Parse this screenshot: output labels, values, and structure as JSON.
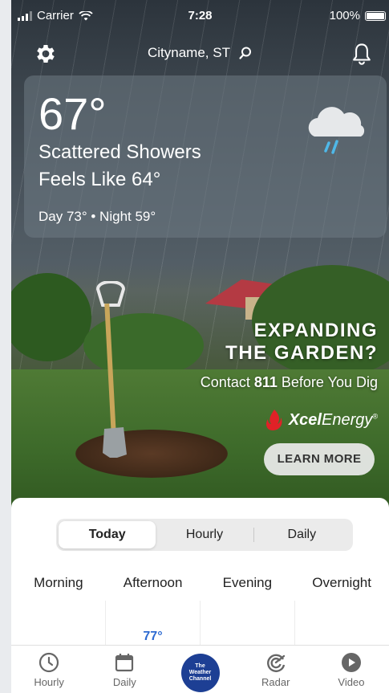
{
  "status": {
    "carrier": "Carrier",
    "time": "7:28",
    "battery": "100%"
  },
  "header": {
    "location": "Cityname, ST"
  },
  "current": {
    "temperature": "67°",
    "phrase": "Scattered Showers",
    "feels_like": "Feels Like 64°",
    "day_night": "Day 73° • Night 59°",
    "icon": "cloud-rain-icon"
  },
  "ad": {
    "headline_1": "EXPANDING",
    "headline_2": "THE GARDEN?",
    "sub_prefix": "Contact ",
    "sub_bold": "811",
    "sub_suffix": " Before You Dig",
    "brand_bold": "Xcel",
    "brand_rest": "Energy",
    "brand_mark": "®",
    "cta": "LEARN MORE"
  },
  "forecast": {
    "tabs": [
      "Today",
      "Hourly",
      "Daily"
    ],
    "active_tab": "Today",
    "dayparts": [
      "Morning",
      "Afternoon",
      "Evening",
      "Overnight"
    ],
    "afternoon_high": "77°"
  },
  "tabbar": {
    "items": [
      {
        "label": "Hourly",
        "icon": "clock-icon"
      },
      {
        "label": "Daily",
        "icon": "calendar-icon"
      },
      {
        "label": "",
        "logo_line1": "The",
        "logo_line2": "Weather",
        "logo_line3": "Channel",
        "icon": "weather-channel-logo"
      },
      {
        "label": "Radar",
        "icon": "radar-icon"
      },
      {
        "label": "Video",
        "icon": "play-icon"
      }
    ]
  },
  "colors": {
    "accent": "#2d6ad1",
    "brand": "#1d3f94"
  }
}
